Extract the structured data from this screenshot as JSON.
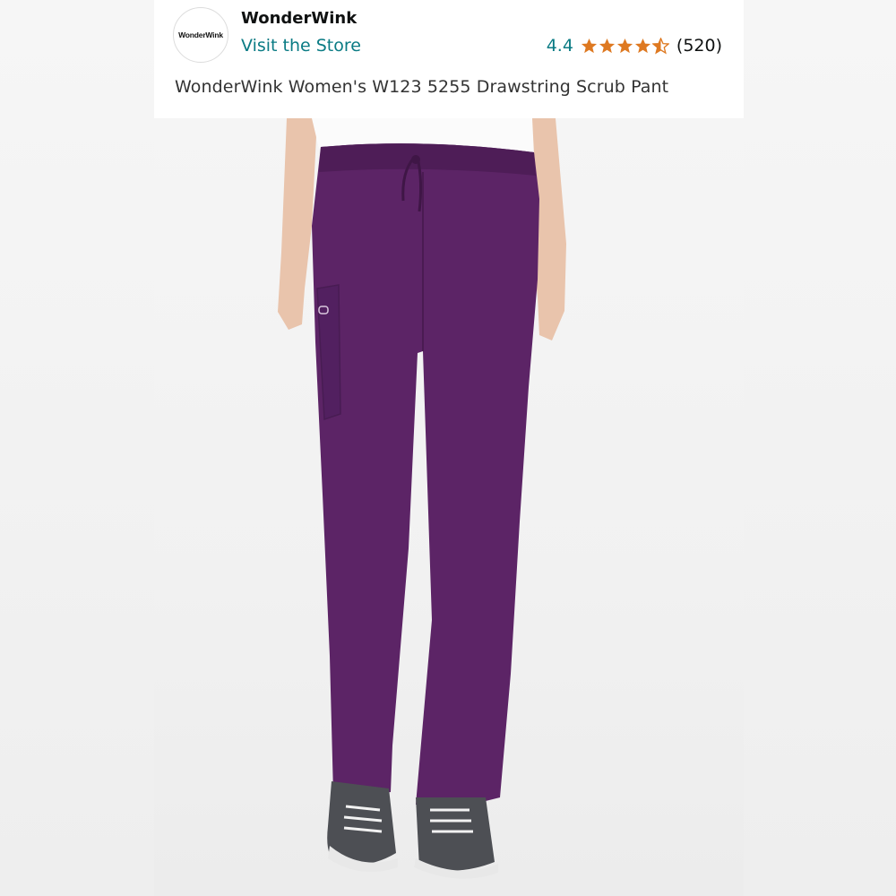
{
  "brand": {
    "logo_text": "WonderWink",
    "name": "WonderWink",
    "store_link": "Visit the Store"
  },
  "rating": {
    "value": "4.4",
    "stars": 4.4,
    "review_count": "(520)",
    "star_color": "#de7921"
  },
  "product": {
    "title": "WonderWink Women's W123 5255 Drawstring Scrub Pant",
    "image_icon": "product-photo-purple-scrub-pants",
    "pant_color": "#5c2466"
  },
  "colors": {
    "link": "#0a7b84",
    "text": "#0f1111"
  }
}
